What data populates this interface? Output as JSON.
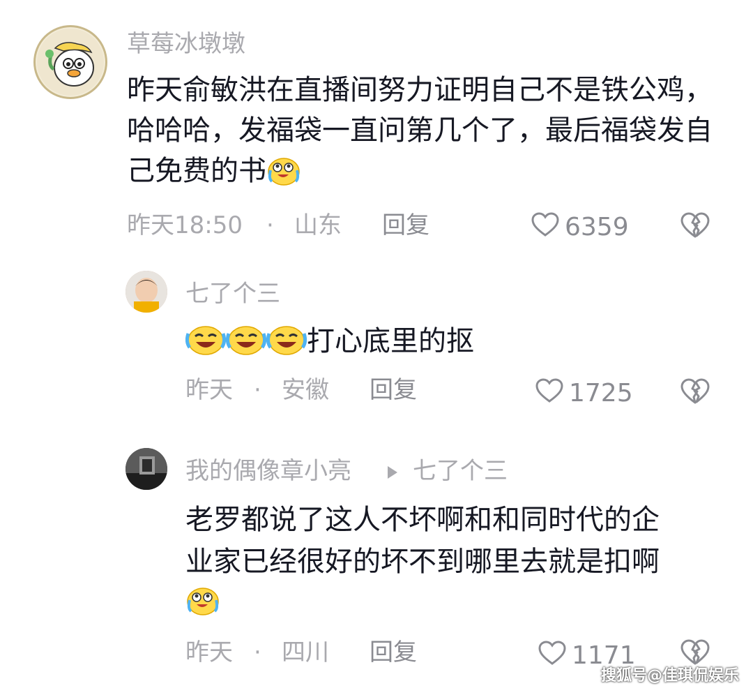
{
  "comments": [
    {
      "username": "草莓冰墩墩",
      "content": "昨天俞敏洪在直播间努力证明自己不是铁公鸡，哈哈哈，发福袋一直问第几个了，最后福袋发自己免费的书",
      "emoji_after": "laugh-cry-emoji",
      "time": "昨天18:50",
      "dot": "·",
      "location": "山东",
      "reply_label": "回复",
      "likes": "6359"
    },
    {
      "username": "七了个三",
      "content": "打心底里的抠",
      "emoji_before": "rofl-emoji x3",
      "time": "昨天",
      "dot": "·",
      "location": "安徽",
      "reply_label": "回复",
      "likes": "1725"
    },
    {
      "username": "我的偶像章小亮",
      "reply_to": "七了个三",
      "content_line1": "老罗都说了这人不坏啊和和同时代的企",
      "content_line2": "业家已经很好的坏不到哪里去就是扣啊",
      "emoji_after": "laugh-cry-emoji",
      "time": "昨天",
      "dot": "·",
      "location": "四川",
      "reply_label": "回复",
      "likes": "1171"
    }
  ],
  "watermark": "搜狐号@佳琪侃娱乐"
}
